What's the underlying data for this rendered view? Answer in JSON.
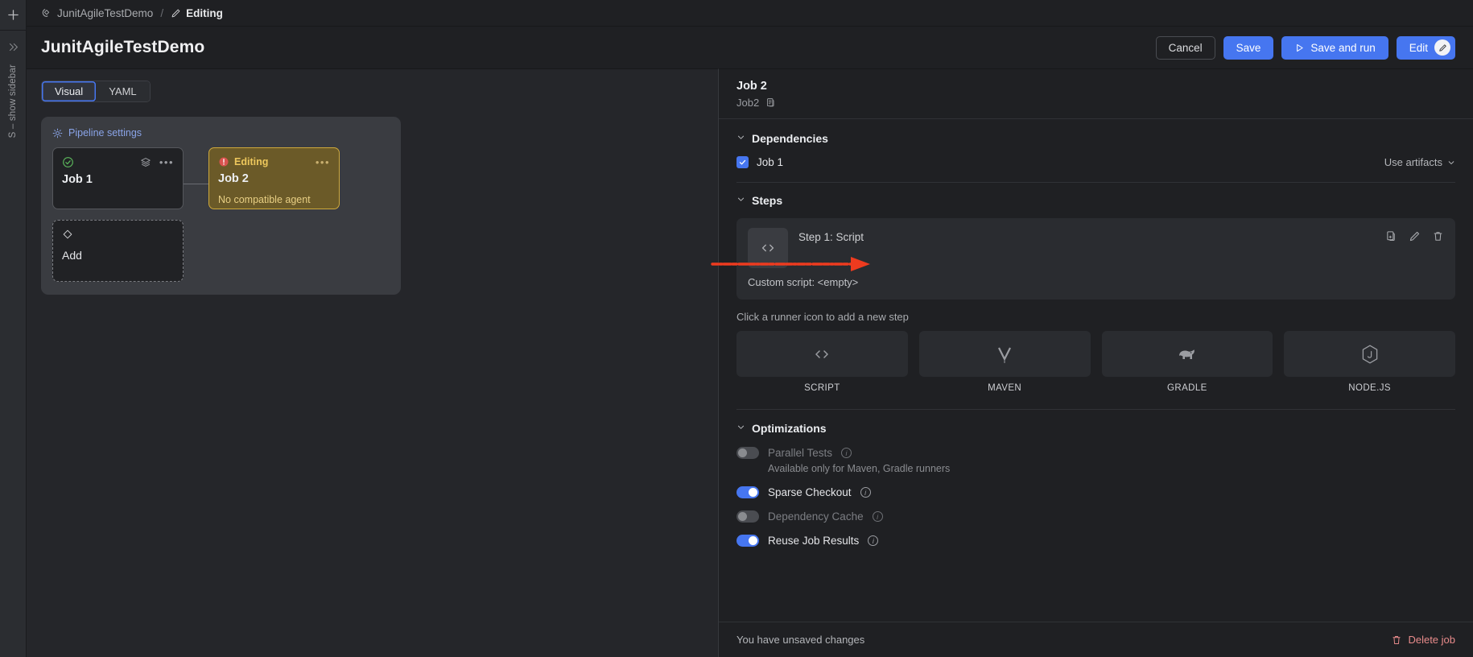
{
  "rail": {
    "add_label": "+",
    "toggle_icon": "chevron-double-right-icon",
    "show_sidebar_text": "S – show sidebar"
  },
  "breadcrumb": {
    "pipeline_icon": "pipeline-diamond-icon",
    "project": "JunitAgileTestDemo",
    "separator": "/",
    "edit_icon": "pencil-icon",
    "current": "Editing"
  },
  "header": {
    "title": "JunitAgileTestDemo",
    "buttons": {
      "cancel": "Cancel",
      "save": "Save",
      "save_and_run": "Save and run",
      "edit": "Edit"
    }
  },
  "editor": {
    "tabs": [
      {
        "label": "Visual",
        "active": true
      },
      {
        "label": "YAML",
        "active": false
      }
    ],
    "pipeline_settings": "Pipeline settings",
    "jobs": [
      {
        "name": "Job 1",
        "status_icon": "check-circle-icon",
        "layers_icon": "layers-icon",
        "menu_icon": "ellipsis-icon",
        "state": "ok"
      },
      {
        "name": "Job 2",
        "status_icon": "warning-circle-icon",
        "status_label": "Editing",
        "menu_icon": "ellipsis-icon",
        "warning": "No compatible agent",
        "state": "editing"
      }
    ],
    "add_node": {
      "label": "Add",
      "icon": "diamond-icon"
    }
  },
  "annotation": {
    "arrow_color": "#ee3b1f",
    "type": "arrow-pointing-right"
  },
  "panel": {
    "title": "Job 2",
    "subtitle": "Job2",
    "copy_icon": "copy-icon",
    "dependencies": {
      "heading": "Dependencies",
      "chevron": "chevron-down-icon",
      "items": [
        {
          "label": "Job 1",
          "checked": true
        }
      ],
      "use_artifacts": "Use artifacts",
      "use_artifacts_chevron": "chevron-down-icon"
    },
    "steps": {
      "heading": "Steps",
      "chevron": "chevron-down-icon",
      "list": [
        {
          "title": "Step 1: Script",
          "icon": "code-icon",
          "description": "Custom script: <empty>",
          "actions": [
            "copy-icon",
            "pencil-icon",
            "trash-icon"
          ]
        }
      ],
      "runner_hint": "Click a runner icon to add a new step",
      "runners": [
        {
          "name": "SCRIPT",
          "icon": "code-icon"
        },
        {
          "name": "MAVEN",
          "icon": "maven-icon"
        },
        {
          "name": "GRADLE",
          "icon": "gradle-elephant-icon"
        },
        {
          "name": "NODE.JS",
          "icon": "nodejs-icon"
        }
      ]
    },
    "optimizations": {
      "heading": "Optimizations",
      "chevron": "chevron-down-icon",
      "items": [
        {
          "label": "Parallel Tests",
          "on": false,
          "disabled": true,
          "note": "Available only for Maven, Gradle runners",
          "info_icon": "info-icon"
        },
        {
          "label": "Sparse Checkout",
          "on": true,
          "disabled": false,
          "note": "",
          "info_icon": "info-icon"
        },
        {
          "label": "Dependency Cache",
          "on": false,
          "disabled": true,
          "note": "",
          "info_icon": "info-icon"
        },
        {
          "label": "Reuse Job Results",
          "on": true,
          "disabled": false,
          "note": "",
          "info_icon": "info-icon"
        }
      ]
    },
    "footer": {
      "status": "You have unsaved changes",
      "delete_label": "Delete job",
      "delete_icon": "trash-icon"
    }
  },
  "colors": {
    "accent": "#4676f0",
    "editing_border": "#cfa93c",
    "editing_bg": "#6b5a28",
    "ok_green": "#5cb85c",
    "warn_red": "#d9534f",
    "danger": "#e88b8b",
    "annotation_red": "#ee3b1f"
  }
}
